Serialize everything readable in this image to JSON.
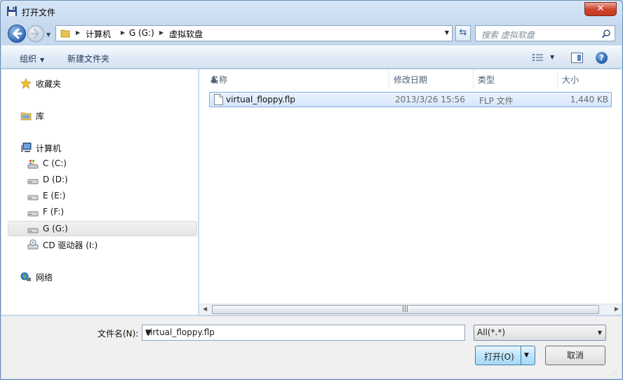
{
  "window": {
    "title": "打开文件",
    "close_label": "✕"
  },
  "address": {
    "crumbs": [
      "计算机",
      "G (G:)",
      "虚拟软盘"
    ],
    "search_placeholder": "搜索 虚拟软盘"
  },
  "toolbar": {
    "organize_label": "组织",
    "new_folder_label": "新建文件夹",
    "help_label": "?"
  },
  "nav": {
    "items": [
      {
        "label": "收藏夹",
        "icon": "star-icon"
      },
      {
        "label": "库",
        "icon": "library-icon"
      },
      {
        "label": "计算机",
        "icon": "computer-icon"
      },
      {
        "label": "C (C:)",
        "icon": "system-drive-icon"
      },
      {
        "label": "D (D:)",
        "icon": "drive-icon"
      },
      {
        "label": "E (E:)",
        "icon": "drive-icon"
      },
      {
        "label": "F (F:)",
        "icon": "drive-icon"
      },
      {
        "label": "G (G:)",
        "icon": "drive-icon",
        "selected": true
      },
      {
        "label": "CD 驱动器 (I:)",
        "icon": "cd-drive-icon"
      },
      {
        "label": "网络",
        "icon": "network-icon"
      }
    ]
  },
  "filelist": {
    "columns": [
      "名称",
      "修改日期",
      "类型",
      "大小"
    ],
    "rows": [
      {
        "name": "virtual_floppy.flp",
        "modified": "2013/3/26 15:56",
        "type": "FLP 文件",
        "size": "1,440 KB",
        "selected": true
      }
    ]
  },
  "bottom": {
    "filename_label": "文件名(N):",
    "filename_value": "virtual_floppy.flp",
    "filetype_value": "All(*.*)",
    "open_label": "打开(O)",
    "cancel_label": "取消"
  },
  "colors": {
    "selection": "#d5e6fb",
    "selection_border": "#84acdd",
    "close_button": "#c23a1f"
  }
}
